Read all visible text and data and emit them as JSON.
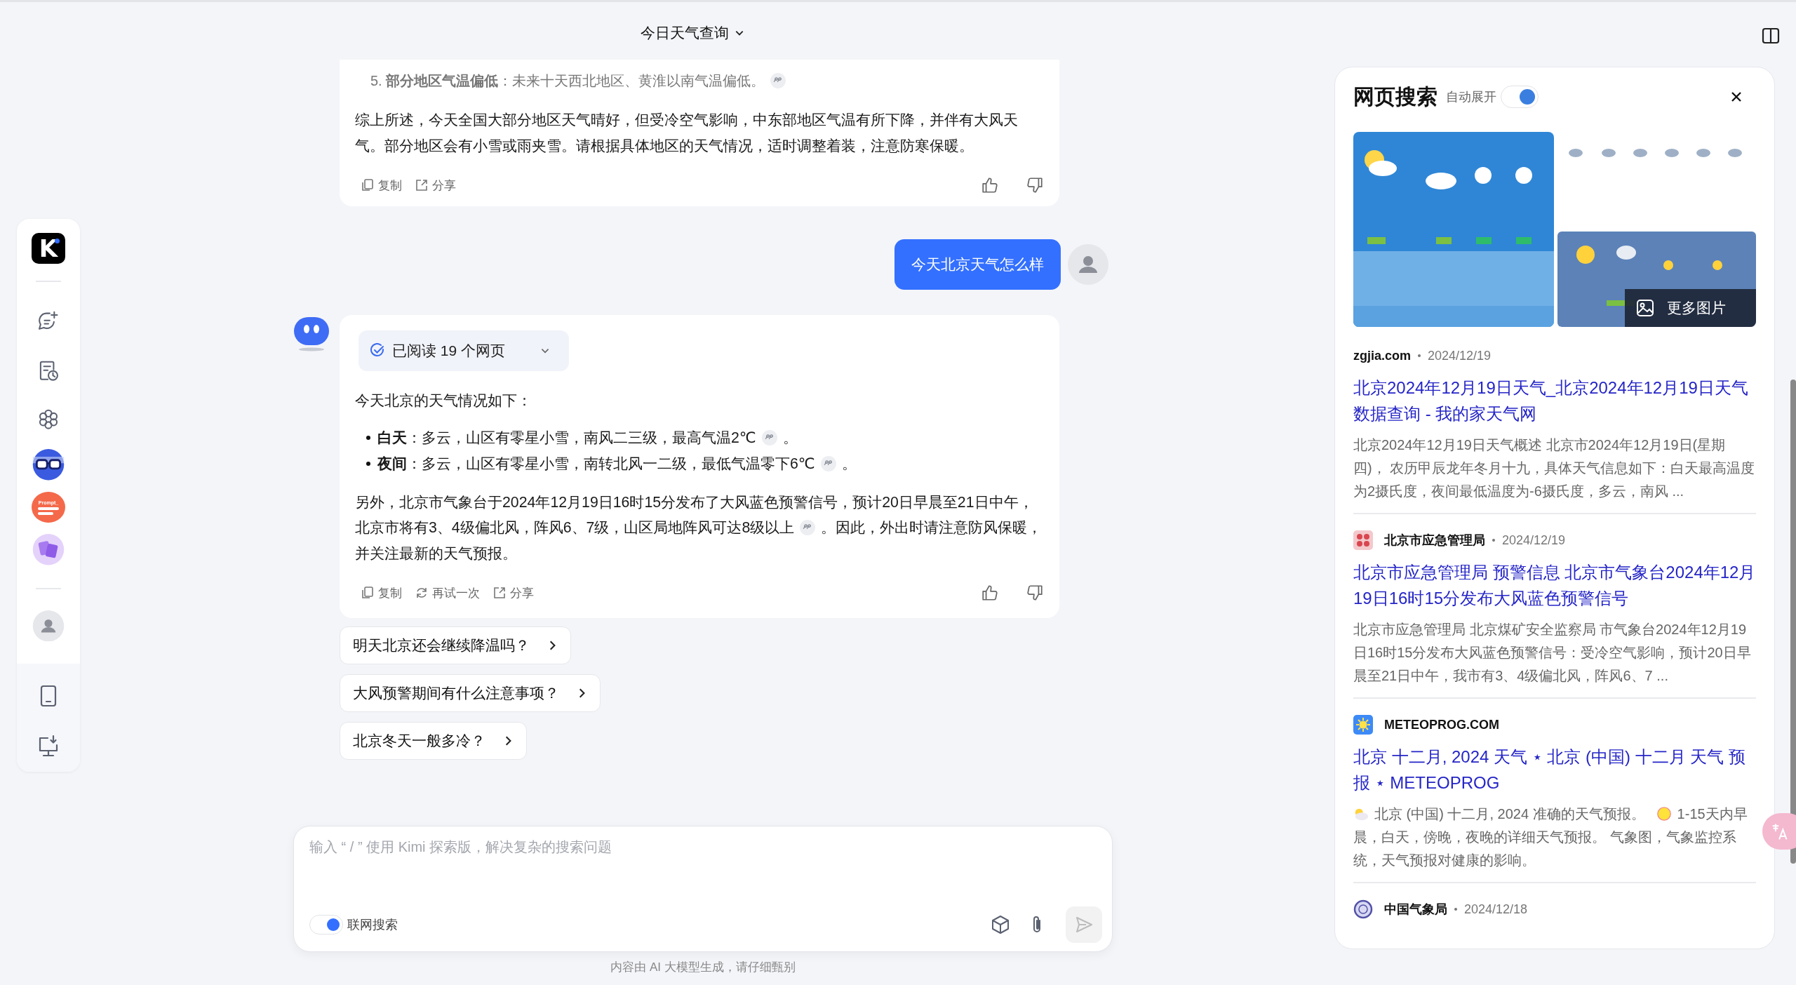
{
  "header": {
    "title": "今日天气查询"
  },
  "sidebar": {
    "logo": "K",
    "top": [
      {
        "kind": "new-chat"
      },
      {
        "kind": "history"
      },
      {
        "kind": "explore"
      },
      {
        "kind": "app-glasses"
      },
      {
        "kind": "app-prompt",
        "label": "Prompt_"
      },
      {
        "kind": "app-image"
      }
    ],
    "account": {
      "kind": "avatar"
    },
    "bottom": [
      {
        "kind": "tablet"
      },
      {
        "kind": "desktop"
      }
    ]
  },
  "earlier_answer": {
    "list_item": [
      {
        "text": "5. **部分地区气温偏低**：未来十天西北地区、黄淮以南气温偏低。",
        "cite": true
      }
    ],
    "summary": [
      {
        "text": "综上所述，今天全国大部分地区天气晴好，但受冷空气影响，中东部地区气温有所下降，并伴有大风天气。部分地区会有小雪或雨夹雪。请根据具体地区的天气情况，适时调整着装，注意防寒保暖。",
        "cite": false
      }
    ],
    "actions": [
      {
        "kind": "copy",
        "label": "复制"
      },
      {
        "kind": "share",
        "label": "分享"
      }
    ]
  },
  "user_message": {
    "text": "今天北京天气怎么样"
  },
  "answer": {
    "sources_label": "已阅读 19 个网页",
    "intro": "今天北京的天气情况如下：",
    "bullets": [
      [
        {
          "text": "**白天**：多云，山区有零星小雪，南风二三级，最高气温2℃",
          "cite": true
        },
        {
          "text": "。",
          "cite": false
        }
      ],
      [
        {
          "text": "**夜间**：多云，山区有零星小雪，南转北风一二级，最低气温零下6℃",
          "cite": true
        },
        {
          "text": "。",
          "cite": false
        }
      ]
    ],
    "paragraph": [
      {
        "text": "另外，北京市气象台于2024年12月19日16时15分发布了大风蓝色预警信号，预计20日早晨至21日中午，北京市将有3、4级偏北风，阵风6、7级，山区局地阵风可达8级以上",
        "cite": true
      },
      {
        "text": "。因此，外出时请注意防风保暖，并关注最新的天气预报。",
        "cite": false
      }
    ],
    "actions": [
      {
        "kind": "copy",
        "label": "复制"
      },
      {
        "kind": "retry",
        "label": "再试一次"
      },
      {
        "kind": "share",
        "label": "分享"
      }
    ]
  },
  "suggestions": [
    "明天北京还会继续降温吗？",
    "大风预警期间有什么注意事项？",
    "北京冬天一般多冷？"
  ],
  "input": {
    "placeholder": "输入 “ / ” 使用 Kimi 探索版，解决复杂的搜索问题",
    "web_search": {
      "label": "联网搜索",
      "on": true
    }
  },
  "footer_note": "内容由 AI 大模型生成，请仔细甄别",
  "search_panel": {
    "title": "网页搜索",
    "auto_expand": {
      "label": "自动展开",
      "on": true
    },
    "more_images": "更多图片",
    "results": [
      {
        "kind": "plain",
        "source": "zgjia.com",
        "date": "2024/12/19",
        "title": "北京2024年12月19日天气_北京2024年12月19日天气数据查询 - 我的家天气网",
        "snippet": [
          {
            "kind": "text",
            "text": "北京2024年12月19日天气概述 北京市2024年12月19日(星期四)， 农历甲辰龙年冬月十九，具体天气信息如下：白天最高温度为2摄氏度，夜间最低温度为-6摄氏度，多云，南风 ..."
          }
        ]
      },
      {
        "kind": "emblem",
        "source": "北京市应急管理局",
        "date": "2024/12/19",
        "title": "北京市应急管理局 预警信息 北京市气象台2024年12月19日16时15分发布大风蓝色预警信号",
        "snippet": [
          {
            "kind": "text",
            "text": "北京市应急管理局 北京煤矿安全监察局 市气象台2024年12月19日16时15分发布大风蓝色预警信号：受冷空气影响，预计20日早晨至21日中午，我市有3、4级偏北风，阵风6、7 ..."
          }
        ]
      },
      {
        "kind": "sun",
        "source": "METEOPROG.COM",
        "title": "北京 十二月, 2024 天气 ⋆ 北京 (中国) 十二月 天气 预报 ⋆ METEOPROG",
        "snippet": [
          {
            "kind": "cloud"
          },
          {
            "kind": "text",
            "text": "北京 (中国) 十二月, 2024 准确的天气预报。"
          },
          {
            "kind": "sun"
          },
          {
            "kind": "text",
            "text": "1-15天内早晨，白天，傍晚，夜晚的详细天气预报。 气象图，气象监控系统，天气预报对健康的影响。"
          }
        ]
      },
      {
        "kind": "seal",
        "source": "中国气象局",
        "date": "2024/12/18"
      }
    ]
  }
}
